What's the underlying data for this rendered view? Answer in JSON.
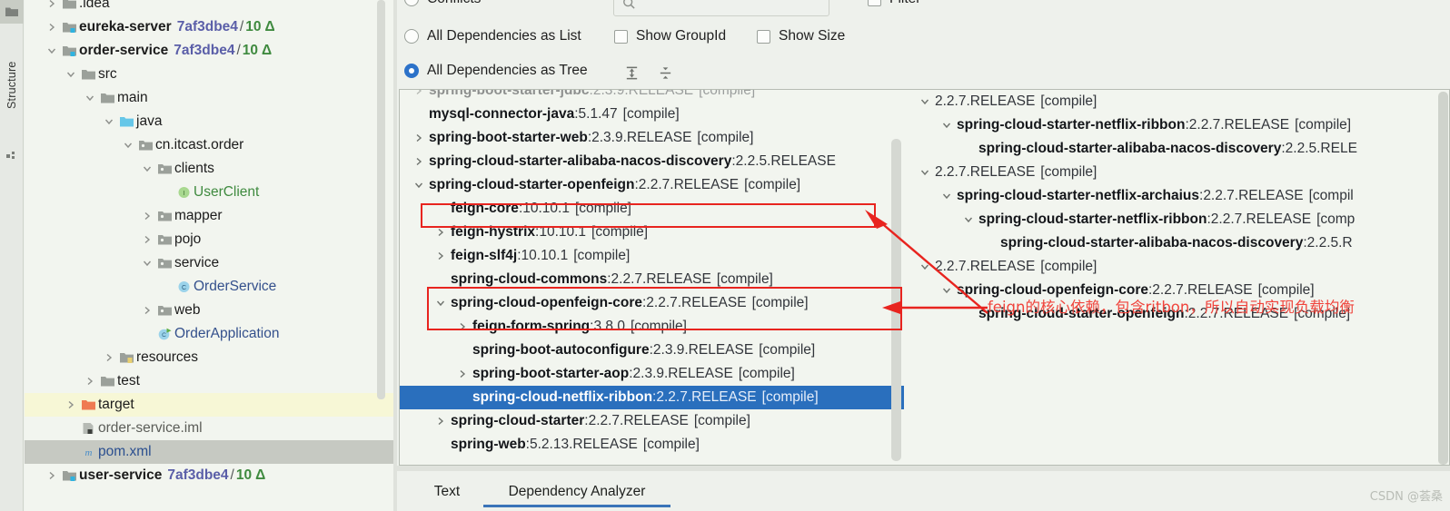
{
  "toolwindow": {
    "label": "Structure",
    "folder_icon": "folder-icon",
    "structure_icon": "structure-icon"
  },
  "project_tree": {
    "scrollbar": "vertical-scrollbar",
    "rows": [
      {
        "indent": 1,
        "arrow": "right",
        "icon": "folder-icon",
        "name": ".idea",
        "bold": false,
        "name_class": "plain",
        "hash": "",
        "count": "",
        "highlight": ""
      },
      {
        "indent": 1,
        "arrow": "right",
        "icon": "module-icon",
        "name": "eureka-server",
        "bold": true,
        "name_class": "",
        "hash": "7af3dbe4",
        "count": "10",
        "delta": "Δ",
        "highlight": ""
      },
      {
        "indent": 1,
        "arrow": "down",
        "icon": "module-icon",
        "name": "order-service",
        "bold": true,
        "name_class": "",
        "hash": "7af3dbe4",
        "count": "10",
        "delta": "Δ",
        "highlight": ""
      },
      {
        "indent": 2,
        "arrow": "down",
        "icon": "folder-icon",
        "name": "src",
        "bold": false,
        "name_class": "plain",
        "hash": "",
        "count": "",
        "highlight": ""
      },
      {
        "indent": 3,
        "arrow": "down",
        "icon": "folder-icon",
        "name": "main",
        "bold": false,
        "name_class": "plain",
        "hash": "",
        "count": "",
        "highlight": ""
      },
      {
        "indent": 4,
        "arrow": "down",
        "icon": "source-folder-icon",
        "name": "java",
        "bold": false,
        "name_class": "plain",
        "hash": "",
        "count": "",
        "highlight": ""
      },
      {
        "indent": 5,
        "arrow": "down",
        "icon": "package-icon",
        "name": "cn.itcast.order",
        "bold": false,
        "name_class": "plain",
        "hash": "",
        "count": "",
        "highlight": ""
      },
      {
        "indent": 6,
        "arrow": "down",
        "icon": "package-icon",
        "name": "clients",
        "bold": false,
        "name_class": "plain",
        "hash": "",
        "count": "",
        "highlight": ""
      },
      {
        "indent": 7,
        "arrow": "none",
        "icon": "interface-icon",
        "name": "UserClient",
        "bold": false,
        "name_class": "cls-green",
        "hash": "",
        "count": "",
        "highlight": ""
      },
      {
        "indent": 6,
        "arrow": "right",
        "icon": "package-icon",
        "name": "mapper",
        "bold": false,
        "name_class": "plain",
        "hash": "",
        "count": "",
        "highlight": ""
      },
      {
        "indent": 6,
        "arrow": "right",
        "icon": "package-icon",
        "name": "pojo",
        "bold": false,
        "name_class": "plain",
        "hash": "",
        "count": "",
        "highlight": ""
      },
      {
        "indent": 6,
        "arrow": "down",
        "icon": "package-icon",
        "name": "service",
        "bold": false,
        "name_class": "plain",
        "hash": "",
        "count": "",
        "highlight": ""
      },
      {
        "indent": 7,
        "arrow": "none",
        "icon": "class-icon",
        "name": "OrderService",
        "bold": false,
        "name_class": "cls-blue",
        "hash": "",
        "count": "",
        "highlight": ""
      },
      {
        "indent": 6,
        "arrow": "right",
        "icon": "package-icon",
        "name": "web",
        "bold": false,
        "name_class": "plain",
        "hash": "",
        "count": "",
        "highlight": ""
      },
      {
        "indent": 6,
        "arrow": "none",
        "icon": "runnable-class-icon",
        "name": "OrderApplication",
        "bold": false,
        "name_class": "cls-blue",
        "hash": "",
        "count": "",
        "highlight": ""
      },
      {
        "indent": 4,
        "arrow": "right",
        "icon": "resources-folder-icon",
        "name": "resources",
        "bold": false,
        "name_class": "plain",
        "hash": "",
        "count": "",
        "highlight": ""
      },
      {
        "indent": 3,
        "arrow": "right",
        "icon": "folder-icon",
        "name": "test",
        "bold": false,
        "name_class": "plain",
        "hash": "",
        "count": "",
        "highlight": ""
      },
      {
        "indent": 2,
        "arrow": "right",
        "icon": "excluded-folder-icon",
        "name": "target",
        "bold": false,
        "name_class": "plain",
        "hash": "",
        "count": "",
        "highlight": "yellow"
      },
      {
        "indent": 2,
        "arrow": "none",
        "icon": "iml-file-icon",
        "name": "order-service.iml",
        "bold": false,
        "name_class": "iml-grey",
        "hash": "",
        "count": "",
        "highlight": ""
      },
      {
        "indent": 2,
        "arrow": "none",
        "icon": "maven-file-icon",
        "name": "pom.xml",
        "bold": false,
        "name_class": "pom-blue",
        "hash": "",
        "count": "",
        "highlight": "grey"
      },
      {
        "indent": 1,
        "arrow": "right",
        "icon": "module-icon",
        "name": "user-service",
        "bold": true,
        "name_class": "",
        "hash": "7af3dbe4",
        "count": "10",
        "delta": "Δ",
        "highlight": ""
      }
    ]
  },
  "options": {
    "conflicts_label": "Conflicts",
    "conflicts_selected": false,
    "list_label": "All Dependencies as List",
    "list_selected": false,
    "tree_label": "All Dependencies as Tree",
    "tree_selected": true,
    "show_groupid_label": "Show GroupId",
    "show_groupid_checked": false,
    "show_size_label": "Show Size",
    "show_size_checked": false,
    "filter_label": "Filter",
    "filter_checked": false,
    "search_value": "",
    "search_placeholder": "",
    "expand_all_icon": "expand-all-icon",
    "collapse_all_icon": "collapse-all-icon",
    "search_icon": "search-icon"
  },
  "dependency_tree": {
    "rows": [
      {
        "indent": 0,
        "arrow": "right",
        "artifact": "spring-boot-starter-jdbc",
        "sep": " : ",
        "version": "2.3.9.RELEASE",
        "scope": "[compile]",
        "clipped": true,
        "selected": false
      },
      {
        "indent": 0,
        "arrow": "none",
        "artifact": "mysql-connector-java",
        "sep": " : ",
        "version": "5.1.47",
        "scope": "[compile]",
        "selected": false
      },
      {
        "indent": 0,
        "arrow": "right",
        "artifact": "spring-boot-starter-web",
        "sep": " : ",
        "version": "2.3.9.RELEASE",
        "scope": "[compile]",
        "selected": false
      },
      {
        "indent": 0,
        "arrow": "right",
        "artifact": "spring-cloud-starter-alibaba-nacos-discovery",
        "sep": " : ",
        "version": "2.2.5.RELEASE",
        "scope": "",
        "selected": false
      },
      {
        "indent": 0,
        "arrow": "down",
        "artifact": "spring-cloud-starter-openfeign",
        "sep": " : ",
        "version": "2.2.7.RELEASE",
        "scope": "[compile]",
        "selected": false
      },
      {
        "indent": 1,
        "arrow": "none",
        "artifact": "feign-core",
        "sep": " : ",
        "version": "10.10.1",
        "scope": "[compile]",
        "selected": false
      },
      {
        "indent": 1,
        "arrow": "right",
        "artifact": "feign-hystrix",
        "sep": " : ",
        "version": "10.10.1",
        "scope": "[compile]",
        "selected": false
      },
      {
        "indent": 1,
        "arrow": "right",
        "artifact": "feign-slf4j",
        "sep": " : ",
        "version": "10.10.1",
        "scope": "[compile]",
        "selected": false
      },
      {
        "indent": 1,
        "arrow": "none",
        "artifact": "spring-cloud-commons",
        "sep": " : ",
        "version": "2.2.7.RELEASE",
        "scope": "[compile]",
        "selected": false
      },
      {
        "indent": 1,
        "arrow": "down",
        "artifact": "spring-cloud-openfeign-core",
        "sep": " : ",
        "version": "2.2.7.RELEASE",
        "scope": "[compile]",
        "selected": false
      },
      {
        "indent": 2,
        "arrow": "right",
        "artifact": "feign-form-spring",
        "sep": " : ",
        "version": "3.8.0",
        "scope": "[compile]",
        "selected": false
      },
      {
        "indent": 2,
        "arrow": "none",
        "artifact": "spring-boot-autoconfigure",
        "sep": " : ",
        "version": "2.3.9.RELEASE",
        "scope": "[compile]",
        "selected": false
      },
      {
        "indent": 2,
        "arrow": "right",
        "artifact": "spring-boot-starter-aop",
        "sep": " : ",
        "version": "2.3.9.RELEASE",
        "scope": "[compile]",
        "selected": false
      },
      {
        "indent": 2,
        "arrow": "none",
        "artifact": "spring-cloud-netflix-ribbon",
        "sep": " : ",
        "version": "2.2.7.RELEASE",
        "scope": "[compile]",
        "selected": true
      },
      {
        "indent": 1,
        "arrow": "right",
        "artifact": "spring-cloud-starter",
        "sep": " : ",
        "version": "2.2.7.RELEASE",
        "scope": "[compile]",
        "selected": false
      },
      {
        "indent": 1,
        "arrow": "none",
        "artifact": "spring-web",
        "sep": " : ",
        "version": "5.2.13.RELEASE",
        "scope": "[compile]",
        "selected": false
      }
    ]
  },
  "usages_tree": {
    "rows": [
      {
        "indent": 0,
        "arrow": "down",
        "artifact": "",
        "sep": "",
        "version": "2.2.7.RELEASE",
        "scope": "[compile]"
      },
      {
        "indent": 1,
        "arrow": "down",
        "artifact": "spring-cloud-starter-netflix-ribbon",
        "sep": " : ",
        "version": "2.2.7.RELEASE",
        "scope": "[compile]"
      },
      {
        "indent": 2,
        "arrow": "none",
        "artifact": "spring-cloud-starter-alibaba-nacos-discovery",
        "sep": " : ",
        "version": "2.2.5.RELE",
        "scope": ""
      },
      {
        "indent": 0,
        "arrow": "down",
        "artifact": "",
        "sep": "",
        "version": "2.2.7.RELEASE",
        "scope": "[compile]"
      },
      {
        "indent": 1,
        "arrow": "down",
        "artifact": "spring-cloud-starter-netflix-archaius",
        "sep": " : ",
        "version": "2.2.7.RELEASE",
        "scope": "[compil"
      },
      {
        "indent": 2,
        "arrow": "down",
        "artifact": "spring-cloud-starter-netflix-ribbon",
        "sep": " : ",
        "version": "2.2.7.RELEASE",
        "scope": "[comp"
      },
      {
        "indent": 3,
        "arrow": "none",
        "artifact": "spring-cloud-starter-alibaba-nacos-discovery",
        "sep": " : ",
        "version": "2.2.5.R",
        "scope": ""
      },
      {
        "indent": 0,
        "arrow": "down",
        "artifact": "",
        "sep": "",
        "version": "2.2.7.RELEASE",
        "scope": "[compile]"
      },
      {
        "indent": 1,
        "arrow": "down",
        "artifact": "spring-cloud-openfeign-core",
        "sep": " : ",
        "version": "2.2.7.RELEASE",
        "scope": "[compile]"
      },
      {
        "indent": 2,
        "arrow": "none",
        "artifact": "spring-cloud-starter-openfeign",
        "sep": " : ",
        "version": "2.2.7.RELEASE",
        "scope": "[compile]"
      }
    ]
  },
  "annotations": {
    "note_text": "feign的核心依赖，包含ritbon，所以自动实现负载均衡",
    "note_color": "#f0443c",
    "box_color": "#e8241f"
  },
  "bottom_tabs": {
    "items": [
      {
        "label": "Text",
        "active": false
      },
      {
        "label": "Dependency Analyzer",
        "active": true
      }
    ]
  },
  "watermark": {
    "text": "CSDN @荟桑"
  },
  "colors": {
    "selection_blue": "#2a6fbd",
    "accent_blue": "#2c72c9",
    "annotation_red": "#e8241f",
    "panel_bg": "#f2f5ef",
    "chrome_bg": "#eef1ec"
  }
}
